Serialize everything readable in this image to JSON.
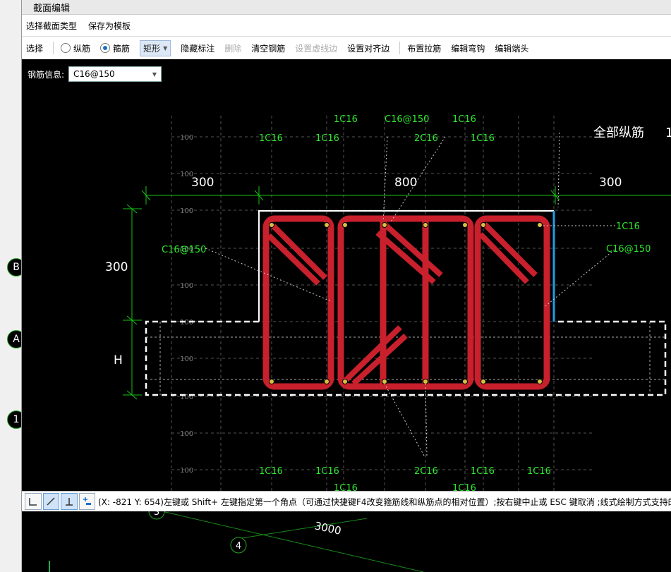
{
  "background": {
    "markers": [
      "B",
      "A",
      "1"
    ],
    "labels": [
      "3",
      "4",
      "3000"
    ]
  },
  "title": "截面编辑",
  "menu": [
    "选择截面类型",
    "保存为模板"
  ],
  "toolbar": {
    "select": "选择",
    "radio_long": "纵筋",
    "radio_stirrup": "箍筋",
    "shape": "矩形",
    "hide_labels": "隐藏标注",
    "delete": "删除",
    "clear": "清空钢筋",
    "set_virtual": "设置虚线边",
    "set_align": "设置对齐边",
    "tie": "布置拉筋",
    "hook": "编辑弯钩",
    "end": "编辑端头"
  },
  "rebar_info": {
    "label": "钢筋信息:",
    "value": "C16@150"
  },
  "drawing": {
    "dims": {
      "left": "300",
      "middle": "800",
      "right": "300",
      "height": "300",
      "h": "H"
    },
    "grid_labels": [
      "100",
      "100",
      "100",
      "100",
      "100",
      "100",
      "100",
      "100",
      "100",
      "100",
      "100"
    ],
    "top_row1": [
      "1C16",
      "C16@150",
      "1C16"
    ],
    "top_row2": [
      "1C16",
      "1C16",
      "2C16",
      "1C16"
    ],
    "bottom_row1": [
      "1C16",
      "1C16",
      "2C16",
      "1C16",
      "1C16"
    ],
    "bottom_row2": [
      "1C16",
      "1C16"
    ],
    "all_longitudinal": "全部纵筋",
    "all_longitudinal_suffix": "1",
    "right_1c16": "1C16",
    "right_stirrup": "C16@150",
    "left_stirrup": "C16@150"
  },
  "colors": {
    "rebar": "#c8202c",
    "dim": "#16c216",
    "label": "#2ee82e",
    "outline": "#ffffff",
    "edge": "#1aa0e8"
  },
  "status": "(X: -821 Y: 654)左键或 Shift+ 左键指定第一个角点（可通过快捷键F4改变箍筋线和纵筋点的相对位置）;按右键中止或 ESC 键取消 ;线式绘制方式支持的钢"
}
